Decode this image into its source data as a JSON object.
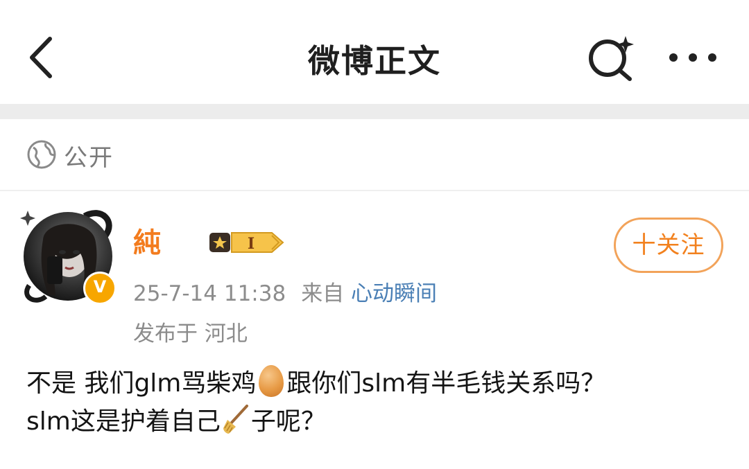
{
  "header": {
    "title": "微博正文",
    "back_icon": "chevron-left-icon",
    "search_icon": "sparkle-search-icon",
    "more_icon": "more-horizontal-icon"
  },
  "visibility": {
    "icon": "globe-icon",
    "label": "公开"
  },
  "post": {
    "author": {
      "name": "純",
      "verified_icon": "v-verified-icon",
      "level_badge_icon": "level-badge-icon",
      "level": "I"
    },
    "follow_label": "十关注",
    "date": "25-7-14 11:38",
    "source_prefix": "来自",
    "source": "心动瞬间",
    "location": "发布于 河北",
    "content": {
      "line1_a": "不是 我们glm骂柴鸡",
      "emoji1": "egg-emoji",
      "line1_b": "跟你们slm有半毛钱关系吗？",
      "line2_a": "slm这是护着自己",
      "emoji2": "broom-emoji",
      "line2_b": "子呢？"
    }
  },
  "colors": {
    "accent_orange": "#f37c1e",
    "link_blue": "#4a7fb5",
    "meta_gray": "#8c8c8c",
    "separator": "#ececec"
  }
}
